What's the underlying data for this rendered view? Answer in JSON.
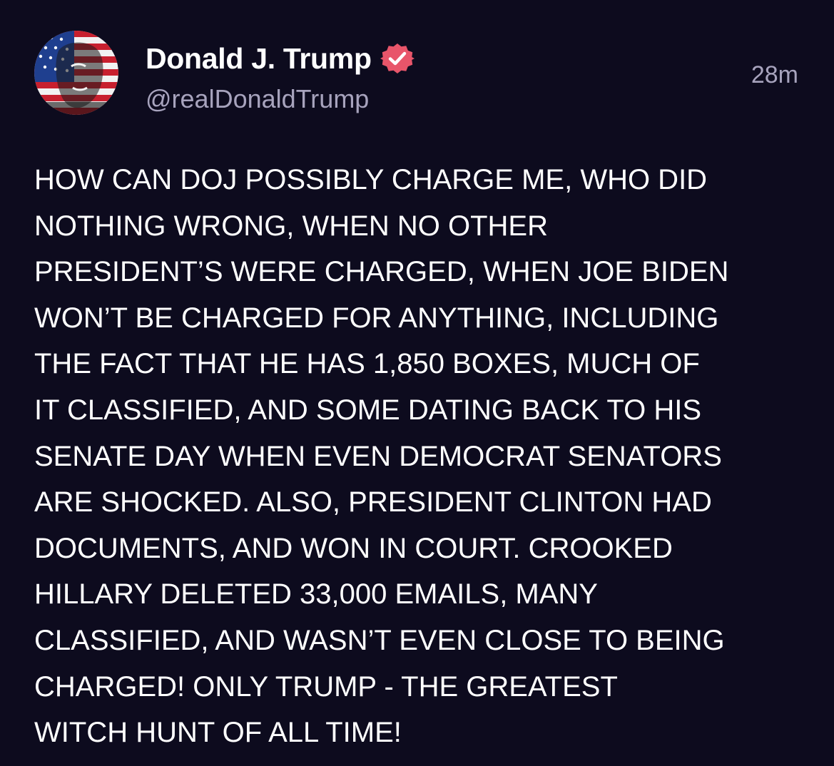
{
  "author": {
    "display_name": "Donald J. Trump",
    "handle": "@realDonaldTrump",
    "verified": true,
    "avatar_icon": "avatar-flag-portrait"
  },
  "post": {
    "timestamp": "28m",
    "lines": [
      "HOW CAN DOJ POSSIBLY CHARGE ME, WHO DID",
      "NOTHING WRONG, WHEN NO OTHER",
      "PRESIDENT’S WERE CHARGED, WHEN JOE BIDEN",
      "WON’T BE CHARGED FOR ANYTHING, INCLUDING",
      "THE FACT THAT HE HAS 1,850 BOXES, MUCH OF",
      "IT CLASSIFIED, AND SOME DATING BACK TO HIS",
      "SENATE DAY WHEN EVEN DEMOCRAT SENATORS",
      "ARE SHOCKED. ALSO, PRESIDENT CLINTON HAD",
      "DOCUMENTS, AND WON IN COURT. CROOKED",
      "HILLARY DELETED 33,000 EMAILS, MANY",
      "CLASSIFIED, AND WASN’T EVEN CLOSE TO BEING",
      "CHARGED! ONLY TRUMP - THE GREATEST",
      "WITCH HUNT OF ALL TIME!"
    ]
  },
  "colors": {
    "background": "#0d0b1e",
    "text": "#ffffff",
    "secondary_text": "#a7a3bd",
    "verified_badge": "#e8556a"
  }
}
